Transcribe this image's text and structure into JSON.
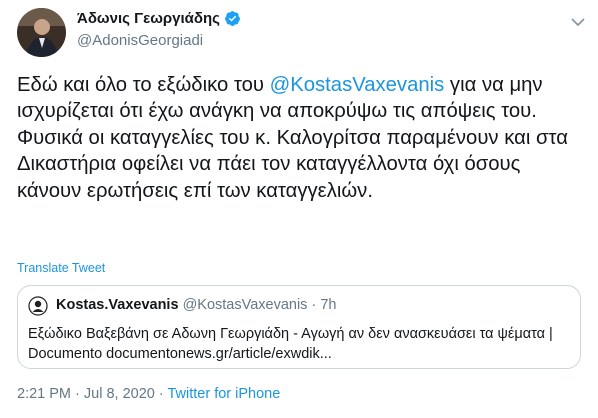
{
  "tweet": {
    "author_name": "Άδωνις Γεωργιάδης",
    "author_handle": "@AdonisGeorgiadi",
    "text_before": "Εδώ και όλο το εξώδικο του ",
    "mention": "@KostasVaxevanis",
    "text_after": " για να μην ισχυρίζεται ότι έχω ανάγκη να αποκρύψω τις απόψεις του. Φυσικά οι καταγγελίες του κ. Καλογρίτσα παραμένουν και στα Δικαστήρια οφείλει να πάει τον καταγγέλλοντα όχι όσους κάνουν ερωτήσεις επί των καταγγελιών.",
    "translate_label": "Translate Tweet",
    "time": "2:21 PM",
    "separator": " · ",
    "date": "Jul 8, 2020",
    "source": "Twitter for iPhone"
  },
  "quote": {
    "author_name": "Kostas.Vaxevanis",
    "author_handle": "@KostasVaxevanis",
    "separator": " · ",
    "age": "7h",
    "text": "Εξώδικο Βαξεβάνη σε Αδωνη Γεωργιάδη - Αγωγή αν δεν ανασκευάσει τα ψέματα | Documento documentonews.gr/article/exwdik..."
  },
  "colors": {
    "accent": "#1b95e0",
    "text": "#14171a",
    "secondary": "#657786",
    "border": "#ccd6dd"
  },
  "icons": {
    "verified": "verified-badge-icon",
    "chevron": "chevron-down-icon"
  }
}
